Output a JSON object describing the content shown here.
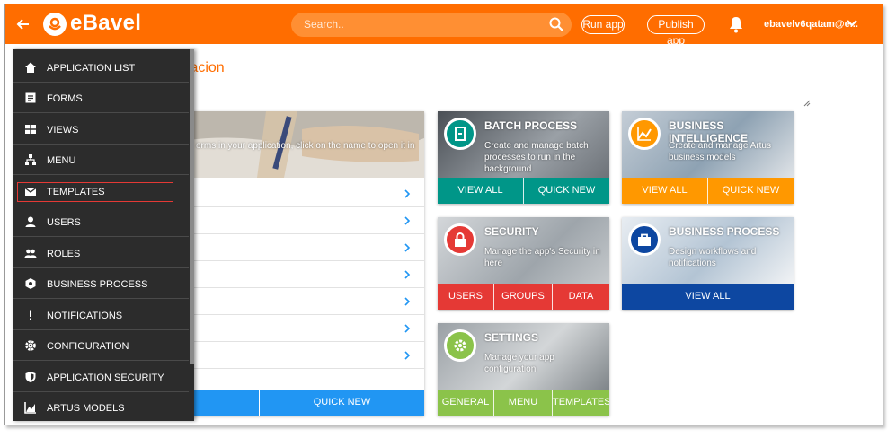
{
  "header": {
    "app_name": "eBavel",
    "search_placeholder": "Search..",
    "run_app": "Run app",
    "publish_app": "Publish app",
    "user": "ebavelv6qatam@e..."
  },
  "page": {
    "title": "tacion"
  },
  "forms_card": {
    "description": "orms in your application, click on the name to open it in",
    "rows": 7,
    "view_all": "",
    "quick_new": "QUICK NEW"
  },
  "tiles": {
    "batch": {
      "title": "BATCH PROCESS",
      "desc": "Create and manage batch processes to run in the background",
      "b1": "VIEW ALL",
      "b2": "QUICK NEW"
    },
    "bi": {
      "title": "BUSINESS INTELLIGENCE",
      "desc": "Create and manage Artus business models",
      "b1": "VIEW ALL",
      "b2": "QUICK NEW"
    },
    "security": {
      "title": "SECURITY",
      "desc": "Manage the app's Security in here",
      "b1": "USERS",
      "b2": "GROUPS",
      "b3": "DATA"
    },
    "bp": {
      "title": "BUSINESS PROCESS",
      "desc": "Design workflows and notifications",
      "b1": "VIEW ALL"
    },
    "settings": {
      "title": "SETTINGS",
      "desc": "Manage your app configuration",
      "b1": "GENERAL",
      "b2": "MENU",
      "b3": "TEMPLATES"
    }
  },
  "menu": {
    "items": [
      {
        "label": "APPLICATION LIST",
        "icon": "home-icon"
      },
      {
        "label": "FORMS",
        "icon": "forms-icon"
      },
      {
        "label": "VIEWS",
        "icon": "views-icon"
      },
      {
        "label": "MENU",
        "icon": "menu-tree-icon"
      },
      {
        "label": "TEMPLATES",
        "icon": "mail-icon"
      },
      {
        "label": "USERS",
        "icon": "user-icon"
      },
      {
        "label": "ROLES",
        "icon": "roles-icon"
      },
      {
        "label": "BUSINESS PROCESS",
        "icon": "process-icon"
      },
      {
        "label": "NOTIFICATIONS",
        "icon": "exclamation-icon"
      },
      {
        "label": "CONFIGURATION",
        "icon": "gear-icon"
      },
      {
        "label": "APPLICATION SECURITY",
        "icon": "shield-icon"
      },
      {
        "label": "ARTUS MODELS",
        "icon": "chart-icon"
      }
    ],
    "selected": "TEMPLATES"
  },
  "colors": {
    "brand": "#ff6d00",
    "batch": "#009688",
    "bi": "#ff9800",
    "security": "#e53935",
    "bp": "#0d47a1",
    "settings": "#8bc34a",
    "forms": "#2196f3"
  }
}
